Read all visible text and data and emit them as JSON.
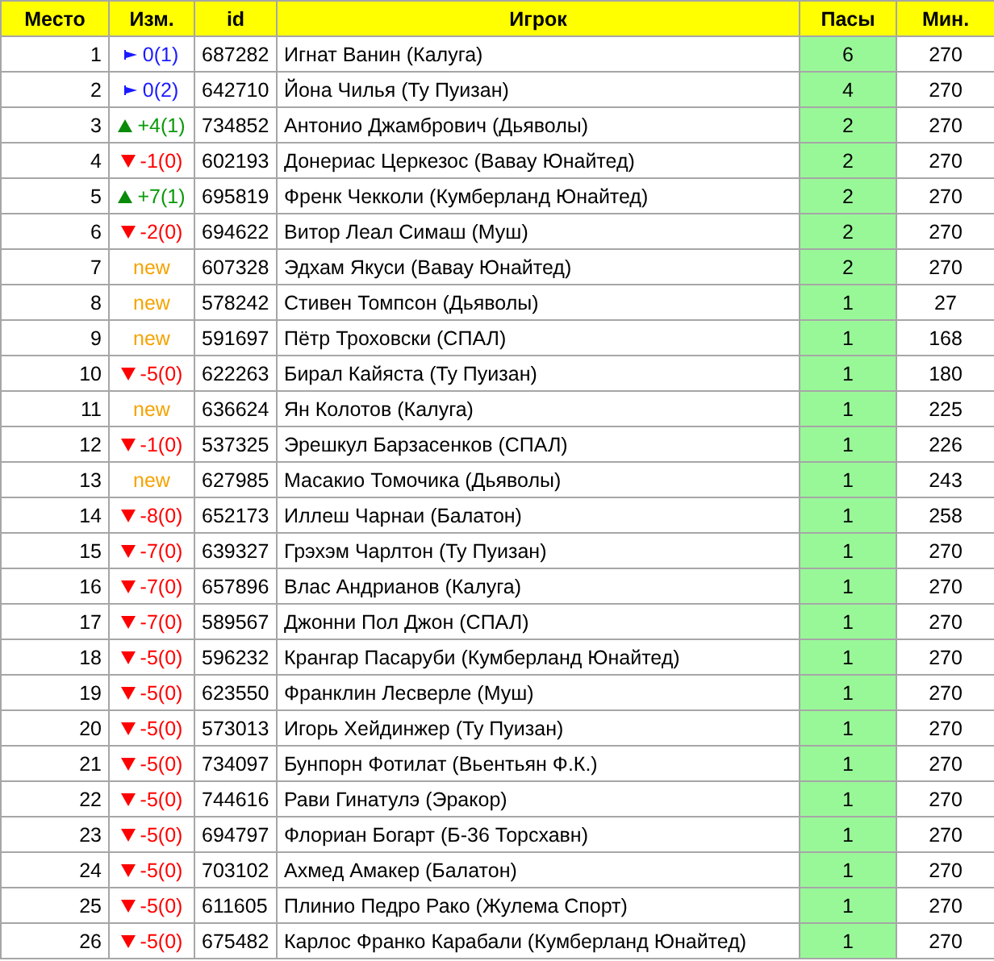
{
  "table": {
    "columns": [
      "Место",
      "Изм.",
      "id",
      "Игрок",
      "Пасы",
      "Мин."
    ],
    "rows": [
      {
        "place": "1",
        "change": {
          "kind": "same",
          "text": "0(1)"
        },
        "id": "687282",
        "player": "Игнат Ванин (Калуга)",
        "assists": "6",
        "minutes": "270"
      },
      {
        "place": "2",
        "change": {
          "kind": "same",
          "text": "0(2)"
        },
        "id": "642710",
        "player": "Йона Чилья (Ту Пуизан)",
        "assists": "4",
        "minutes": "270"
      },
      {
        "place": "3",
        "change": {
          "kind": "up",
          "text": "+4(1)"
        },
        "id": "734852",
        "player": "Антонио Джамбрович (Дьяволы)",
        "assists": "2",
        "minutes": "270"
      },
      {
        "place": "4",
        "change": {
          "kind": "down",
          "text": "-1(0)"
        },
        "id": "602193",
        "player": "Донериас Церкезос (Вавау Юнайтед)",
        "assists": "2",
        "minutes": "270"
      },
      {
        "place": "5",
        "change": {
          "kind": "up",
          "text": "+7(1)"
        },
        "id": "695819",
        "player": "Френк Чекколи (Кумберланд Юнайтед)",
        "assists": "2",
        "minutes": "270"
      },
      {
        "place": "6",
        "change": {
          "kind": "down",
          "text": "-2(0)"
        },
        "id": "694622",
        "player": "Витор Леал Симаш (Муш)",
        "assists": "2",
        "minutes": "270"
      },
      {
        "place": "7",
        "change": {
          "kind": "new",
          "text": "new"
        },
        "id": "607328",
        "player": "Эдхам Якуси (Вавау Юнайтед)",
        "assists": "2",
        "minutes": "270"
      },
      {
        "place": "8",
        "change": {
          "kind": "new",
          "text": "new"
        },
        "id": "578242",
        "player": "Стивен Томпсон (Дьяволы)",
        "assists": "1",
        "minutes": "27"
      },
      {
        "place": "9",
        "change": {
          "kind": "new",
          "text": "new"
        },
        "id": "591697",
        "player": "Пётр Троховски (СПАЛ)",
        "assists": "1",
        "minutes": "168"
      },
      {
        "place": "10",
        "change": {
          "kind": "down",
          "text": "-5(0)"
        },
        "id": "622263",
        "player": "Бирал Кайяста (Ту Пуизан)",
        "assists": "1",
        "minutes": "180"
      },
      {
        "place": "11",
        "change": {
          "kind": "new",
          "text": "new"
        },
        "id": "636624",
        "player": "Ян Колотов (Калуга)",
        "assists": "1",
        "minutes": "225"
      },
      {
        "place": "12",
        "change": {
          "kind": "down",
          "text": "-1(0)"
        },
        "id": "537325",
        "player": "Эрешкул Барзасенков (СПАЛ)",
        "assists": "1",
        "minutes": "226"
      },
      {
        "place": "13",
        "change": {
          "kind": "new",
          "text": "new"
        },
        "id": "627985",
        "player": "Масакио Томочика (Дьяволы)",
        "assists": "1",
        "minutes": "243"
      },
      {
        "place": "14",
        "change": {
          "kind": "down",
          "text": "-8(0)"
        },
        "id": "652173",
        "player": "Иллеш Чарнаи (Балатон)",
        "assists": "1",
        "minutes": "258"
      },
      {
        "place": "15",
        "change": {
          "kind": "down",
          "text": "-7(0)"
        },
        "id": "639327",
        "player": "Грэхэм Чарлтон (Ту Пуизан)",
        "assists": "1",
        "minutes": "270"
      },
      {
        "place": "16",
        "change": {
          "kind": "down",
          "text": "-7(0)"
        },
        "id": "657896",
        "player": "Влас Андрианов (Калуга)",
        "assists": "1",
        "minutes": "270"
      },
      {
        "place": "17",
        "change": {
          "kind": "down",
          "text": "-7(0)"
        },
        "id": "589567",
        "player": "Джонни Пол Джон (СПАЛ)",
        "assists": "1",
        "minutes": "270"
      },
      {
        "place": "18",
        "change": {
          "kind": "down",
          "text": "-5(0)"
        },
        "id": "596232",
        "player": "Крангар Пасаруби (Кумберланд Юнайтед)",
        "assists": "1",
        "minutes": "270"
      },
      {
        "place": "19",
        "change": {
          "kind": "down",
          "text": "-5(0)"
        },
        "id": "623550",
        "player": "Франклин Лесверле (Муш)",
        "assists": "1",
        "minutes": "270"
      },
      {
        "place": "20",
        "change": {
          "kind": "down",
          "text": "-5(0)"
        },
        "id": "573013",
        "player": "Игорь Хейдинжер (Ту Пуизан)",
        "assists": "1",
        "minutes": "270"
      },
      {
        "place": "21",
        "change": {
          "kind": "down",
          "text": "-5(0)"
        },
        "id": "734097",
        "player": "Бунпорн Фотилат (Вьентьян Ф.К.)",
        "assists": "1",
        "minutes": "270"
      },
      {
        "place": "22",
        "change": {
          "kind": "down",
          "text": "-5(0)"
        },
        "id": "744616",
        "player": "Рави Гинатулэ (Эракор)",
        "assists": "1",
        "minutes": "270"
      },
      {
        "place": "23",
        "change": {
          "kind": "down",
          "text": "-5(0)"
        },
        "id": "694797",
        "player": "Флориан Богарт (Б-36 Торсхавн)",
        "assists": "1",
        "minutes": "270"
      },
      {
        "place": "24",
        "change": {
          "kind": "down",
          "text": "-5(0)"
        },
        "id": "703102",
        "player": "Ахмед Амакер (Балатон)",
        "assists": "1",
        "minutes": "270"
      },
      {
        "place": "25",
        "change": {
          "kind": "down",
          "text": "-5(0)"
        },
        "id": "611605",
        "player": "Плинио Педро Рако (Жулема Спорт)",
        "assists": "1",
        "minutes": "270"
      },
      {
        "place": "26",
        "change": {
          "kind": "down",
          "text": "-5(0)"
        },
        "id": "675482",
        "player": "Карлос Франко Карабали (Кумберланд Юнайтед)",
        "assists": "1",
        "minutes": "270"
      }
    ]
  }
}
